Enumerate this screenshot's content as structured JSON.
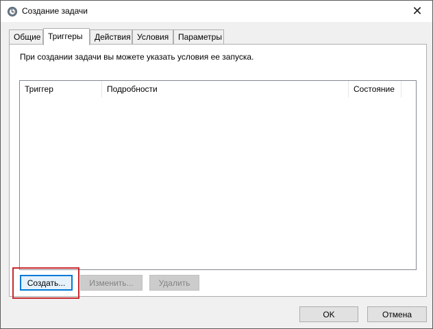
{
  "window": {
    "title": "Создание задачи"
  },
  "tabs": [
    {
      "label": "Общие",
      "active": false
    },
    {
      "label": "Триггеры",
      "active": true
    },
    {
      "label": "Действия",
      "active": false
    },
    {
      "label": "Условия",
      "active": false
    },
    {
      "label": "Параметры",
      "active": false
    }
  ],
  "triggers": {
    "description": "При создании задачи вы можете указать условия ее запуска.",
    "columns": [
      "Триггер",
      "Подробности",
      "Состояние"
    ],
    "rows": [],
    "buttons": {
      "create": "Создать...",
      "edit": "Изменить...",
      "delete": "Удалить"
    }
  },
  "footer": {
    "ok": "OK",
    "cancel": "Отмена"
  },
  "colors": {
    "highlight": "#c8282d",
    "default_button_border": "#0078d7"
  },
  "icons": {
    "title": "clock-icon",
    "close": "close-icon"
  }
}
